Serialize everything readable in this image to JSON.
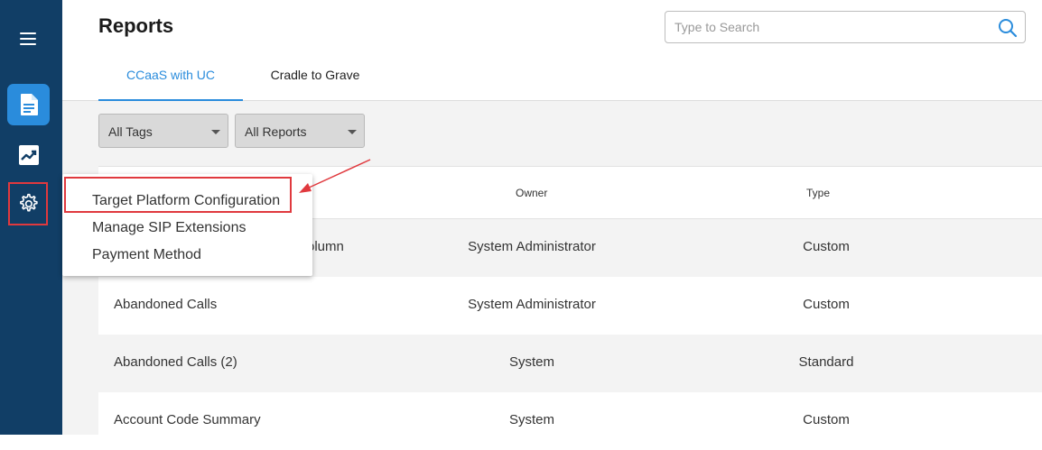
{
  "header": {
    "title": "Reports",
    "search_placeholder": "Type to Search"
  },
  "sidebar": {
    "items": [
      {
        "name": "menu",
        "icon": "hamburger-icon"
      },
      {
        "name": "reports",
        "icon": "document-icon",
        "active": true
      },
      {
        "name": "analytics",
        "icon": "trending-up-icon"
      },
      {
        "name": "settings",
        "icon": "gear-icon",
        "highlighted": true
      }
    ]
  },
  "tabs": [
    {
      "label": "CCaaS with UC",
      "active": true
    },
    {
      "label": "Cradle to Grave",
      "active": false
    }
  ],
  "filters": {
    "tags": "All Tags",
    "reports": "All Reports"
  },
  "table": {
    "columns": [
      "Owner",
      "Type"
    ],
    "rows": [
      {
        "name": "olumn",
        "owner": "System Administrator",
        "type": "Custom"
      },
      {
        "name": "Abandoned Calls",
        "owner": "System Administrator",
        "type": "Custom"
      },
      {
        "name": "Abandoned Calls (2)",
        "owner": "System",
        "type": "Standard"
      },
      {
        "name": "Account Code Summary",
        "owner": "System",
        "type": "Custom"
      }
    ]
  },
  "settings_menu": {
    "items": [
      "Target Platform Configuration",
      "Manage SIP Extensions",
      "Payment Method"
    ],
    "highlighted_index": 0
  },
  "colors": {
    "sidebar": "#113e66",
    "accent": "#2a8cdc",
    "annotation": "#e0393e"
  }
}
